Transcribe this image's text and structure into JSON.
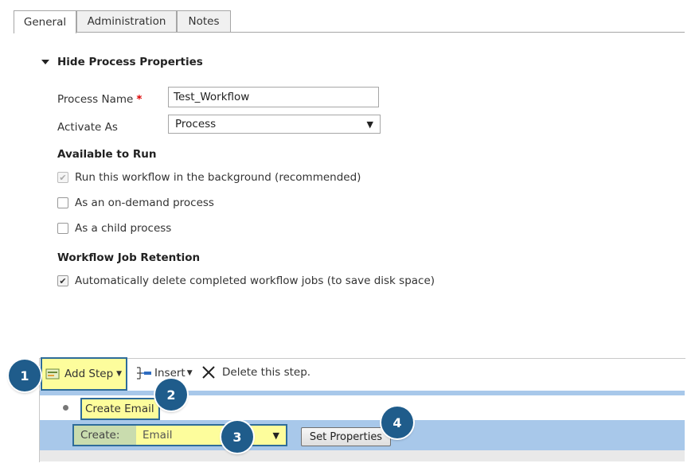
{
  "tabs": [
    {
      "label": "General",
      "active": true
    },
    {
      "label": "Administration",
      "active": false
    },
    {
      "label": "Notes",
      "active": false
    }
  ],
  "section": {
    "toggle_label": "Hide Process Properties"
  },
  "fields": {
    "process_name_label": "Process Name",
    "required_mark": "*",
    "process_name_value": "Test_Workflow",
    "activate_as_label": "Activate As",
    "activate_as_value": "Process"
  },
  "available_to_run": {
    "title": "Available to Run",
    "options": [
      {
        "label": "Run this workflow in the background (recommended)",
        "checked": true,
        "disabled": true
      },
      {
        "label": "As an on-demand process",
        "checked": false,
        "disabled": false
      },
      {
        "label": "As a child process",
        "checked": false,
        "disabled": false
      }
    ]
  },
  "retention": {
    "title": "Workflow Job Retention",
    "option": {
      "label": "Automatically delete completed workflow jobs (to save disk space)",
      "checked": true
    }
  },
  "toolbar": {
    "add_step": "Add Step",
    "insert": "Insert",
    "delete": "Delete this step."
  },
  "step": {
    "name": "Create Email",
    "create_label": "Create:",
    "entity_value": "Email",
    "set_properties": "Set Properties"
  },
  "callouts": [
    "1",
    "2",
    "3",
    "4"
  ],
  "colors": {
    "highlight": "#fdfd9c",
    "callout": "#1f5c8b",
    "band": "#a8c8ea"
  }
}
